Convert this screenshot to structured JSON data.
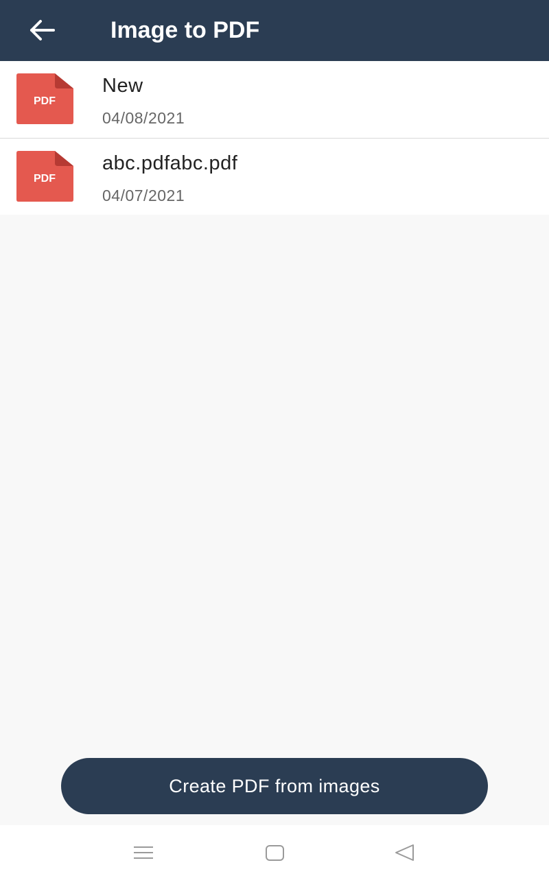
{
  "appbar": {
    "title": "Image to PDF",
    "back_icon": "arrow-left-icon",
    "color": "#2b3d53"
  },
  "files": [
    {
      "name": "New",
      "date": "04/08/2021",
      "icon": "pdf-file-icon",
      "icon_label": "PDF"
    },
    {
      "name": "abc.pdfabc.pdf",
      "date": "04/07/2021",
      "icon": "pdf-file-icon",
      "icon_label": "PDF"
    }
  ],
  "create_button": {
    "label": "Create PDF from images"
  },
  "system_nav": {
    "menu_icon": "menu-icon",
    "home_icon": "home-icon",
    "back_icon": "back-triangle-icon"
  },
  "colors": {
    "primary": "#2b3d53",
    "pdf_red": "#e4594f",
    "pdf_fold": "#b63a33",
    "background": "#f8f8f8"
  }
}
